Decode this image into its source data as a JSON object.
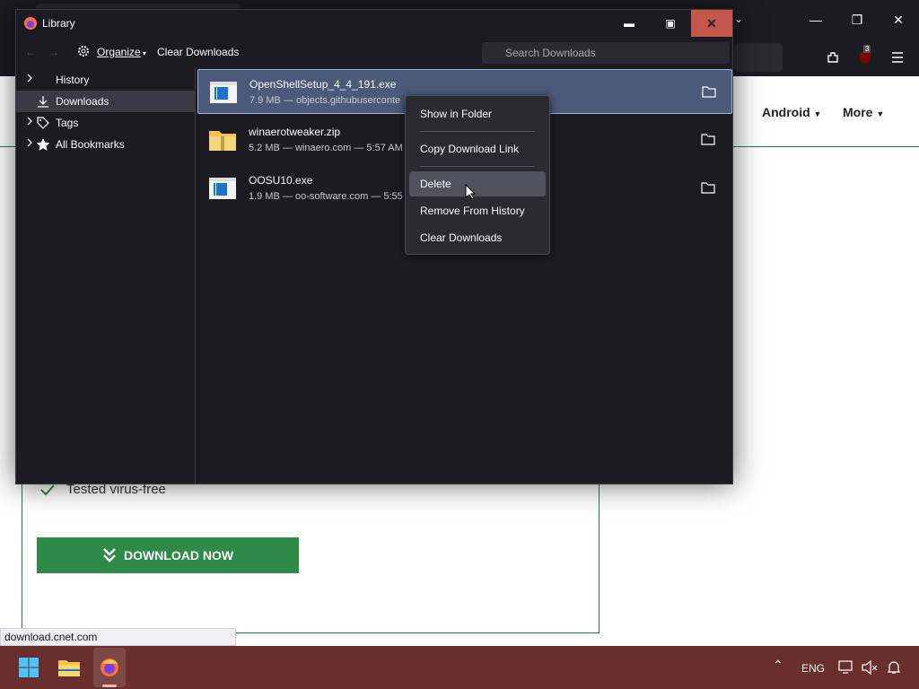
{
  "background": {
    "nav_items": [
      "Android",
      "More"
    ],
    "virus_free_text": "Tested virus-free",
    "download_button": "DOWNLOAD NOW",
    "status_url": "download.cnet.com",
    "extension_badge": "3"
  },
  "library": {
    "title": "Library",
    "toolbar": {
      "organize": "Organize",
      "clear_downloads": "Clear Downloads",
      "search_placeholder": "Search Downloads"
    },
    "sidebar": [
      {
        "label": "History",
        "icon": "clock-icon",
        "selected": false
      },
      {
        "label": "Downloads",
        "icon": "download-icon",
        "selected": true
      },
      {
        "label": "Tags",
        "icon": "tag-icon",
        "selected": false
      },
      {
        "label": "All Bookmarks",
        "icon": "star-icon",
        "selected": false
      }
    ],
    "downloads": [
      {
        "name": "OpenShellSetup_4_4_191.exe",
        "meta": "7.9 MB — objects.githubuserconte",
        "icon": "exe-file-icon"
      },
      {
        "name": "winaerotweaker.zip",
        "meta": "5.2 MB — winaero.com — 5:57 AM",
        "icon": "zip-folder-icon"
      },
      {
        "name": "OOSU10.exe",
        "meta": "1.9 MB — oo-software.com — 5:55",
        "icon": "exe-file-icon"
      }
    ]
  },
  "context_menu": {
    "items": [
      "Show in Folder",
      "Copy Download Link",
      "Delete",
      "Remove From History",
      "Clear Downloads"
    ],
    "highlighted": "Delete"
  },
  "taskbar": {
    "language": "ENG"
  },
  "colors": {
    "close_button": "#c4564a",
    "taskbar": "#6a2f2c",
    "download_button": "#2e8b47",
    "selected_row": "#4a5a78"
  }
}
